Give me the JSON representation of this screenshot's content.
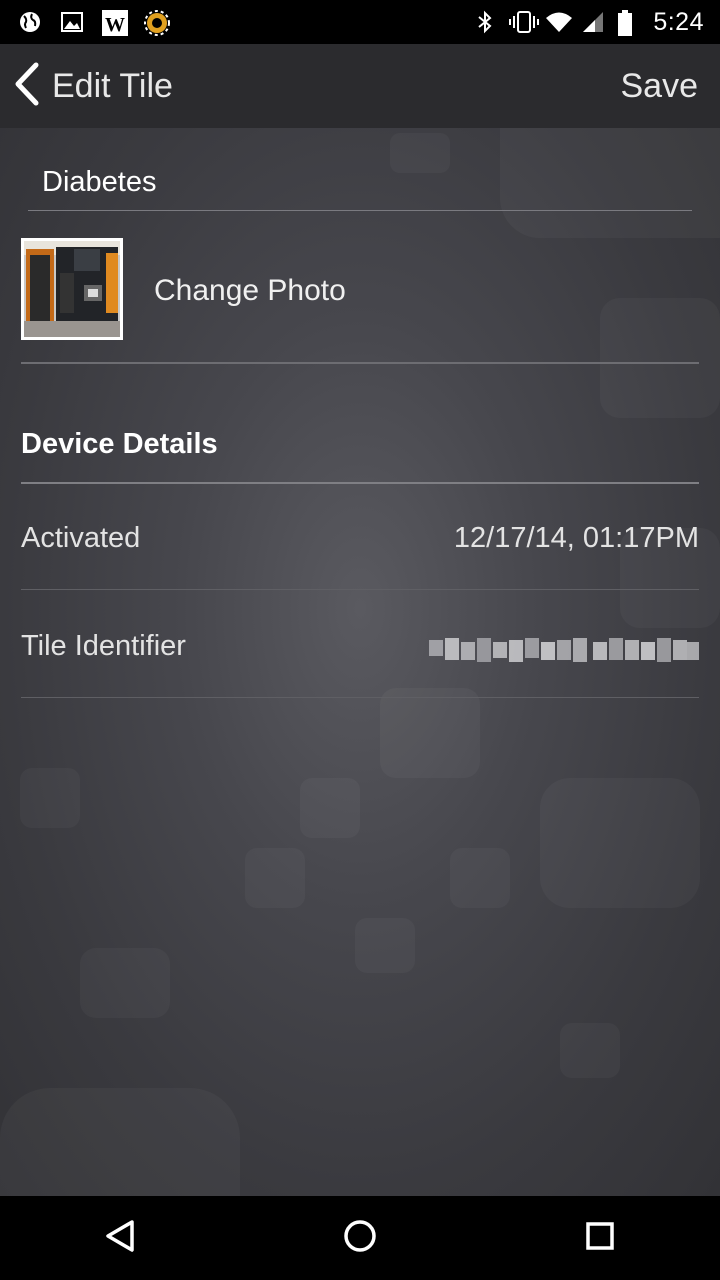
{
  "status_bar": {
    "time": "5:24",
    "left_icons": [
      "globe-icon",
      "image-icon",
      "wikipedia-icon",
      "tasker-icon"
    ],
    "right_icons": [
      "bluetooth-icon",
      "vibrate-icon",
      "wifi-icon",
      "signal-icon",
      "battery-icon"
    ]
  },
  "app_bar": {
    "title": "Edit Tile",
    "save_label": "Save"
  },
  "tile": {
    "name_value": "Diabetes",
    "change_photo_label": "Change Photo"
  },
  "device_details": {
    "heading": "Device Details",
    "rows": [
      {
        "label": "Activated",
        "value": "12/17/14, 01:17PM"
      },
      {
        "label": "Tile Identifier"
      }
    ]
  },
  "nav_bar": {
    "buttons": [
      "back-icon",
      "home-icon",
      "recents-icon"
    ]
  }
}
